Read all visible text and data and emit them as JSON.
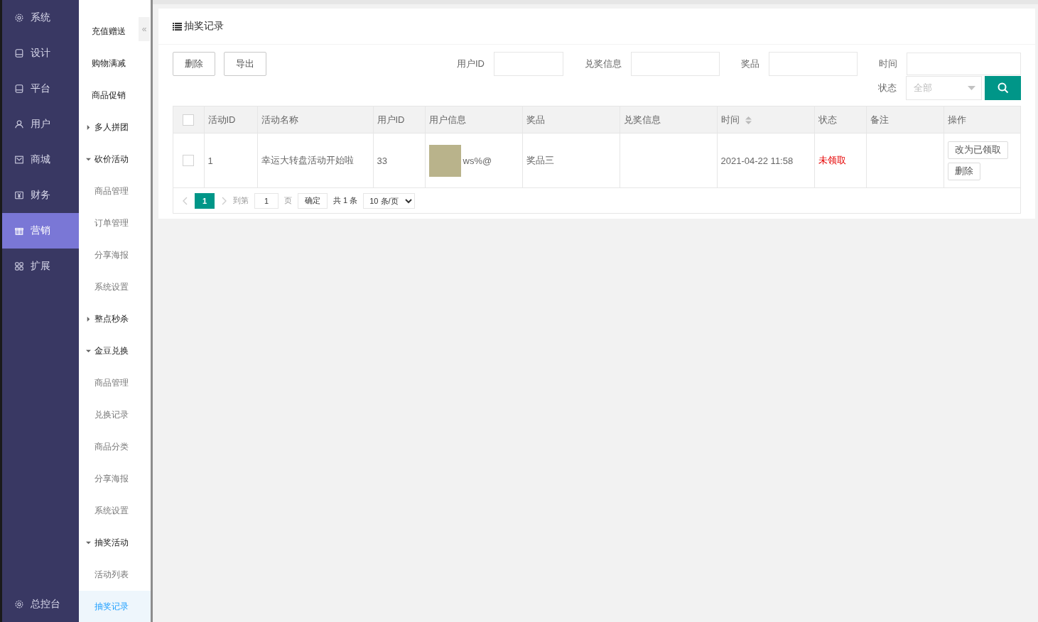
{
  "main_nav": {
    "items": [
      {
        "label": "系统",
        "selected": false
      },
      {
        "label": "设计",
        "selected": false
      },
      {
        "label": "平台",
        "selected": false
      },
      {
        "label": "用户",
        "selected": false
      },
      {
        "label": "商城",
        "selected": false
      },
      {
        "label": "财务",
        "selected": false
      },
      {
        "label": "营销",
        "selected": true
      },
      {
        "label": "扩展",
        "selected": false
      }
    ],
    "footer": {
      "label": "总控台"
    }
  },
  "sub_nav": {
    "collapse_glyph": "«",
    "items": [
      {
        "label": "充值赠送",
        "kind": "link",
        "selected": false
      },
      {
        "label": "购物满减",
        "kind": "link",
        "selected": false
      },
      {
        "label": "商品促销",
        "kind": "link",
        "selected": false
      },
      {
        "label": "多人拼团",
        "kind": "group",
        "expanded": false
      },
      {
        "label": "砍价活动",
        "kind": "group",
        "expanded": true,
        "children": [
          {
            "label": "商品管理",
            "selected": false
          },
          {
            "label": "订单管理",
            "selected": false
          },
          {
            "label": "分享海报",
            "selected": false
          },
          {
            "label": "系统设置",
            "selected": false
          }
        ]
      },
      {
        "label": "整点秒杀",
        "kind": "group",
        "expanded": false
      },
      {
        "label": "金豆兑换",
        "kind": "group",
        "expanded": true,
        "children": [
          {
            "label": "商品管理",
            "selected": false
          },
          {
            "label": "兑换记录",
            "selected": false
          },
          {
            "label": "商品分类",
            "selected": false
          },
          {
            "label": "分享海报",
            "selected": false
          },
          {
            "label": "系统设置",
            "selected": false
          }
        ]
      },
      {
        "label": "抽奖活动",
        "kind": "group",
        "expanded": true,
        "children": [
          {
            "label": "活动列表",
            "selected": false
          },
          {
            "label": "抽奖记录",
            "selected": true
          }
        ]
      }
    ]
  },
  "card": {
    "title": "抽奖记录",
    "actions": [
      "删除",
      "导出"
    ],
    "filters": [
      {
        "label": "用户ID",
        "kind": "input"
      },
      {
        "label": "兑奖信息",
        "kind": "input"
      },
      {
        "label": "奖品",
        "kind": "input"
      },
      {
        "label": "时间",
        "kind": "input"
      }
    ],
    "status_filter": {
      "label": "状态",
      "placeholder": "全部"
    },
    "table": {
      "all_checked": false,
      "columns": [
        {
          "label": "活动ID",
          "sortable": false
        },
        {
          "label": "活动名称",
          "sortable": false
        },
        {
          "label": "用户ID",
          "sortable": false
        },
        {
          "label": "用户信息",
          "sortable": false
        },
        {
          "label": "奖品",
          "sortable": false
        },
        {
          "label": "兑奖信息",
          "sortable": false
        },
        {
          "label": "时间",
          "sortable": true
        },
        {
          "label": "状态",
          "sortable": false
        },
        {
          "label": "备注",
          "sortable": false
        },
        {
          "label": "操作",
          "sortable": false
        }
      ],
      "rows": [
        {
          "checked": false,
          "activity_id": "1",
          "activity_name": "幸运大转盘活动开始啦",
          "user_id": "33",
          "user_name": "ws%@",
          "prize": "奖品三",
          "redeem_info": "",
          "time": "2021-04-22 11:58",
          "status": "未领取",
          "claimed": false,
          "remark": "",
          "actions": [
            "改为已领取",
            "删除"
          ]
        }
      ]
    },
    "pagination": {
      "pages": [
        {
          "label": "1",
          "selected": true
        }
      ],
      "goto_label": "到第",
      "goto_value": "1",
      "page_unit": "页",
      "confirm": "确定",
      "total": "共 1 条",
      "page_size": "10 条/页"
    }
  }
}
